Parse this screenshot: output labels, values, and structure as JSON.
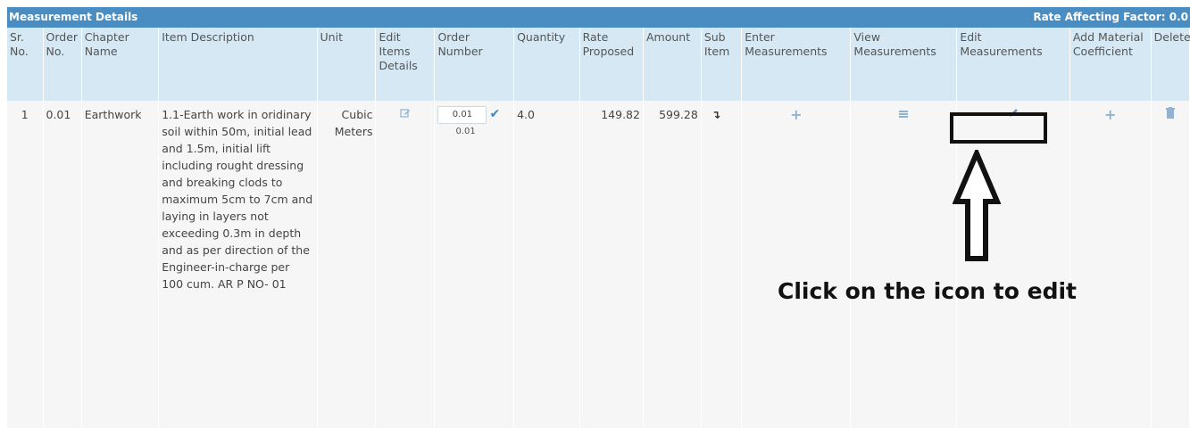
{
  "panel": {
    "title": "Measurement Details",
    "rate_factor": "Rate Affecting Factor: 0.0"
  },
  "columns": [
    "Sr. No.",
    "Order No.",
    "Chapter Name",
    "Item Description",
    "Unit",
    "Edit Items Details",
    "Order Number",
    "Quantity",
    "Rate Proposed",
    "Amount",
    "Sub Item",
    "Enter Measurements",
    "View Measurements",
    "Edit Measurements",
    "Add Material Coefficient",
    "Delete"
  ],
  "row": {
    "sr_no": "1",
    "order_no": "0.01",
    "chapter": "Earthwork",
    "description": "1.1-Earth work in oridinary soil within 50m, initial lead and 1.5m, initial lift including rought dressing and breaking clods to maximum 5cm to 7cm and laying in layers not exceeding 0.3m in depth and as per direction of the Engineer-in-charge per 100 cum. AR P NO- 01",
    "unit": "Cubic Meters",
    "order_input": "0.01",
    "order_sub": "0.01",
    "quantity": "4.0",
    "rate": "149.82",
    "amount": "599.28"
  },
  "icons": {
    "edit_items": "edit-square-icon",
    "confirm": "check-icon",
    "sub_item": "sub-item-arrow-icon",
    "enter_measurements": "plus-icon",
    "view_measurements": "list-icon",
    "edit_measurements": "pencil-icon",
    "add_material": "plus-icon",
    "delete": "trash-icon"
  },
  "annotation": {
    "text": "Click on the icon to edit"
  },
  "colors": {
    "header_bar": "#4a8dc2",
    "column_header": "#d5e8f4",
    "row_bg": "#f6f6f6",
    "icon": "#8fb3d1",
    "annotation": "#111111"
  }
}
